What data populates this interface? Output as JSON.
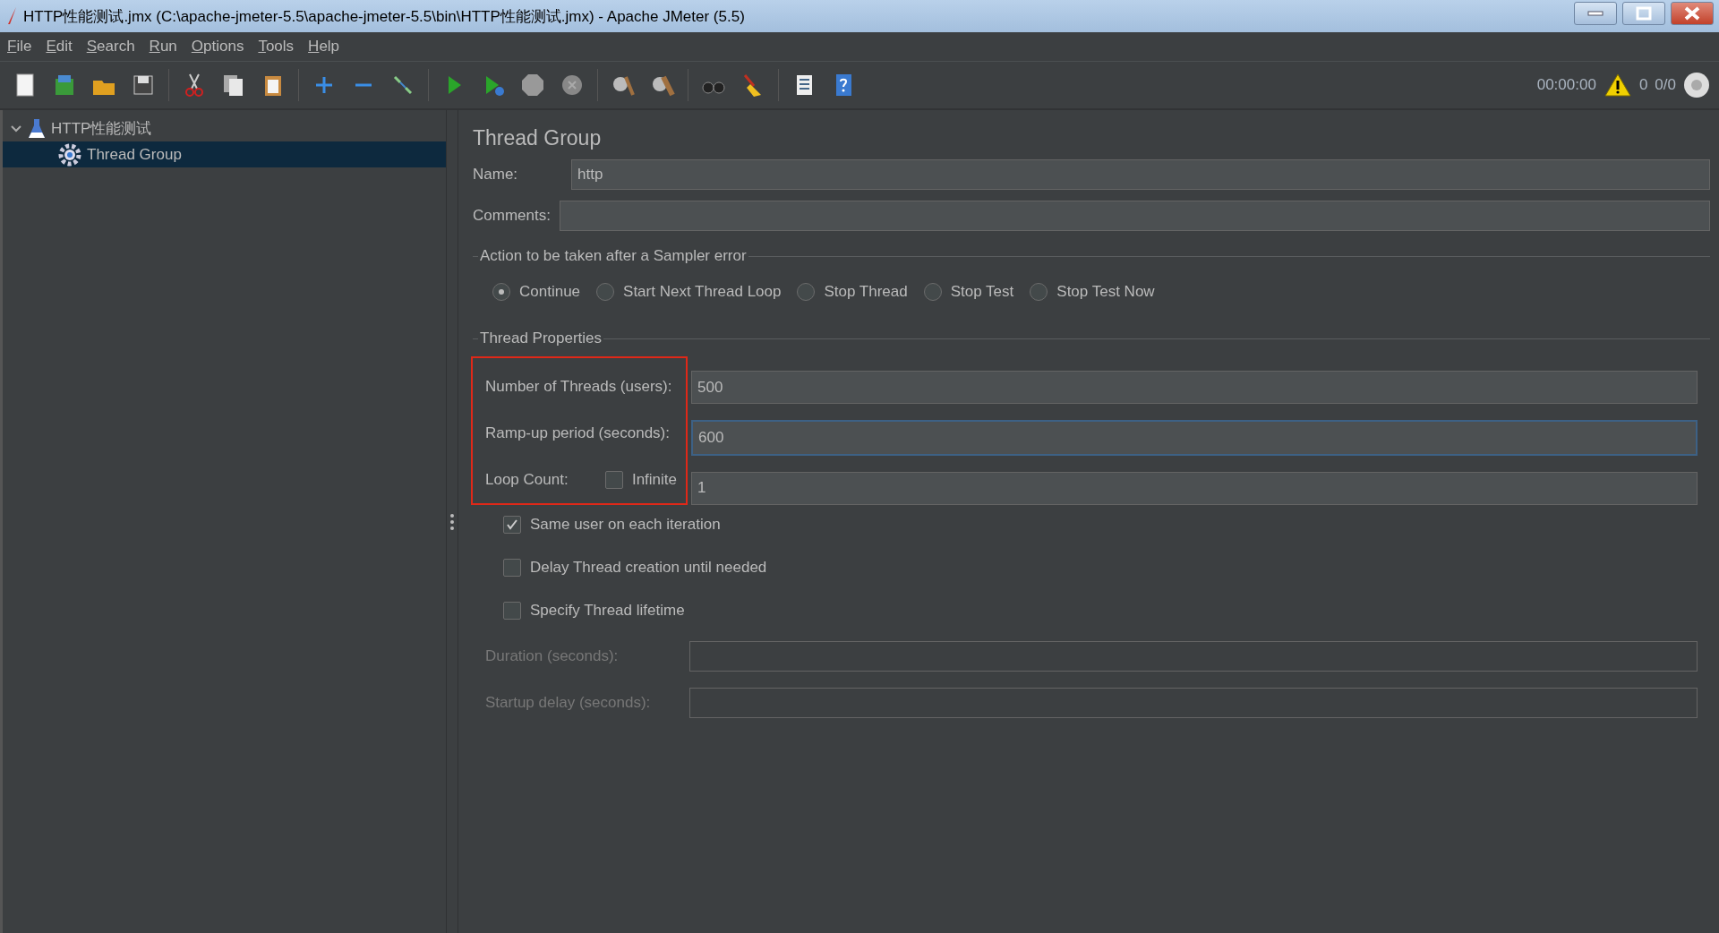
{
  "window": {
    "title": "HTTP性能测试.jmx (C:\\apache-jmeter-5.5\\apache-jmeter-5.5\\bin\\HTTP性能测试.jmx) - Apache JMeter (5.5)"
  },
  "menu": [
    "File",
    "Edit",
    "Search",
    "Run",
    "Options",
    "Tools",
    "Help"
  ],
  "status": {
    "time": "00:00:00",
    "warnings": "0",
    "threads": "0/0"
  },
  "tree": [
    {
      "label": "HTTP性能测试",
      "expanded": true,
      "selected": false,
      "children": [
        {
          "label": "Thread Group",
          "selected": true
        }
      ]
    }
  ],
  "panel": {
    "title": "Thread Group",
    "name": {
      "label": "Name:",
      "value": "http"
    },
    "comments": {
      "label": "Comments:"
    },
    "sampler_error": {
      "title": "Action to be taken after a Sampler error",
      "options": [
        {
          "label": "Continue",
          "selected": true
        },
        {
          "label": "Start Next Thread Loop",
          "selected": false
        },
        {
          "label": "Stop Thread",
          "selected": false
        },
        {
          "label": "Stop Test",
          "selected": false
        },
        {
          "label": "Stop Test Now",
          "selected": false
        }
      ]
    },
    "thread_properties": {
      "title": "Thread Properties",
      "fields": [
        {
          "label": "Number of Threads (users):",
          "value": "500",
          "focused": false
        },
        {
          "label": "Ramp-up period (seconds):",
          "value": "600",
          "focused": true
        }
      ],
      "loop_count": {
        "label": "Loop Count:",
        "infinite": {
          "label": "Infinite",
          "checked": false
        },
        "value": "1"
      }
    },
    "checkboxes": [
      {
        "label": "Same user on each iteration",
        "checked": true
      },
      {
        "label": "Delay Thread creation until needed",
        "checked": false
      },
      {
        "label": "Specify Thread lifetime",
        "checked": false
      }
    ],
    "lifetime_fields": [
      {
        "label": "Duration (seconds):",
        "disabled": true
      },
      {
        "label": "Startup delay (seconds):",
        "disabled": true
      }
    ]
  }
}
